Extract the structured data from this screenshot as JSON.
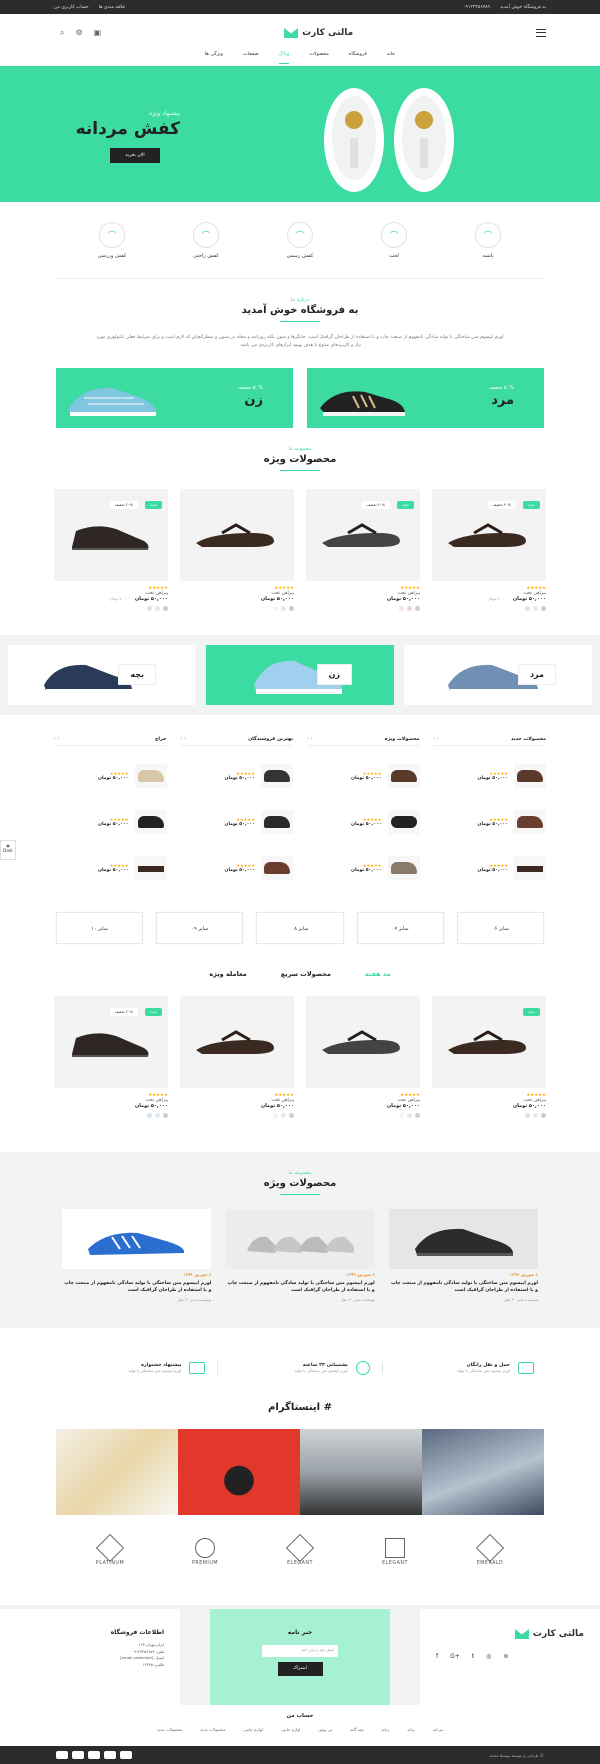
{
  "topbar": {
    "right_text": "به فروشگاه خوش آمدید",
    "phone": "۰۹۱۲۳۴۵۶۷۸۹",
    "wishlist": "علاقه مندی ها",
    "account": "حساب کاربری من"
  },
  "header": {
    "logo": "مالتی کارت"
  },
  "nav": [
    "خانه",
    "فروشگاه",
    "محصولات",
    "وبلاگ",
    "صفحات",
    "ویژگی ها"
  ],
  "hero": {
    "sub": "پیشنهاد ویژه",
    "title": "کفش مردانه",
    "button": "الان بخرید"
  },
  "categories": [
    "پاشنه",
    "لخت",
    "کفش رسمی",
    "کفش راحتی",
    "کفش ورزشی"
  ],
  "welcome": {
    "small": "درباره ما",
    "title": "به فروشگاه خوش آمدید",
    "text": "لورم ایپسوم متن ساختگی با تولید سادگی نامفهوم از صنعت چاپ و با استفاده از طراحان گرافیک است. چاپگرها و متون بلکه روزنامه و مجله در ستون و سطرآنچنان که لازم است و برای شرایط فعلی تکنولوژی مورد نیاز و کاربردهای متنوع با هدف بهبود ابزارهای کاربردی می باشد."
  },
  "banners": [
    {
      "sub": "۵۰% تخفیف",
      "title": "مرد"
    },
    {
      "sub": "۵۰% تخفیف",
      "title": "زن"
    }
  ],
  "featured": {
    "small": "مجموعه ما",
    "title": "محصولات ویژه"
  },
  "product_cards": [
    {
      "badge": "جدید",
      "discount": "۲۰% تخفیف",
      "name": "پیراهن تخت",
      "price": "۵۰,۰۰۰ تومان",
      "old": "۷۰,۰۰۰ تومان"
    },
    {
      "badge": "جدید",
      "discount": "۲۰% تخفیف",
      "name": "پیراهن تخت",
      "price": "۵۰,۰۰۰ تومان",
      "old": ""
    },
    {
      "badge": "",
      "discount": "",
      "name": "پیراهن تخت",
      "price": "۵۰,۰۰۰ تومان",
      "old": ""
    },
    {
      "badge": "جدید",
      "discount": "۲۰% تخفیف",
      "name": "پیراهن تخت",
      "price": "۵۰,۰۰۰ تومان",
      "old": "۷۰,۰۰۰ تومان"
    }
  ],
  "big_cats": [
    "مرد",
    "زن",
    "بچه"
  ],
  "lists": [
    {
      "title": "محصولات جدید",
      "items": [
        {
          "price": "۵۰,۰۰۰ تومان"
        },
        {
          "price": "۵۰,۰۰۰ تومان"
        },
        {
          "price": "۵۰,۰۰۰ تومان"
        }
      ]
    },
    {
      "title": "محصولات ویژه",
      "items": [
        {
          "price": "۵۰,۰۰۰ تومان"
        },
        {
          "price": "۵۰,۰۰۰ تومان"
        },
        {
          "price": "۵۰,۰۰۰ تومان"
        }
      ]
    },
    {
      "title": "بهترین فروشندگان",
      "items": [
        {
          "price": "۵۰,۰۰۰ تومان"
        },
        {
          "price": "۵۰,۰۰۰ تومان"
        },
        {
          "price": "۵۰,۰۰۰ تومان"
        }
      ]
    },
    {
      "title": "حراج",
      "items": [
        {
          "price": "۵۰,۰۰۰ تومان"
        },
        {
          "price": "۵۰,۰۰۰ تومان"
        },
        {
          "price": "۵۰,۰۰۰ تومان"
        }
      ]
    }
  ],
  "sizes": [
    "سایز ۰۶",
    "سایز ۰۷",
    "سایز ۰۸",
    "سایز ۰۹",
    "سایز ۱۰"
  ],
  "tabs": [
    "مد هفته",
    "محصولات سریع",
    "معامله ویژه"
  ],
  "blog": {
    "small": "مجموعه ما",
    "title": "محصولات ویژه",
    "posts": [
      {
        "date": "۸ شهریور ۱۳۹۹",
        "title": "لورم ایپسوم متن ساختگی با تولید سادگی نامفهوم از صنعت چاپ و با استفاده از طراحان گرافیک است",
        "author": "نویسنده مدیر ۳۰ نظر"
      },
      {
        "date": "۸ شهریور ۱۳۹۹",
        "title": "لورم ایپسوم متن ساختگی با تولید سادگی نامفهوم از صنعت چاپ و با استفاده از طراحان گرافیک است",
        "author": "نویسنده مدیر ۳۰ نظر"
      },
      {
        "date": "۸ شهریور ۱۳۹۹",
        "title": "لورم ایپسوم متن ساختگی با تولید سادگی نامفهوم از صنعت چاپ و با استفاده از طراحان گرافیک است",
        "author": "نویسنده مدیر ۳۰ نظر"
      }
    ]
  },
  "features": [
    {
      "title": "حمل و نقل رایگان",
      "desc": "لورم ایپسوم متن ساختگی با تولید"
    },
    {
      "title": "پشتیبانی ۲۴ ساعته",
      "desc": "لورم ایپسوم متن ساختگی با تولید"
    },
    {
      "title": "پیشنهاد جشنواره",
      "desc": "لورم ایپسوم متن ساختگی با تولید"
    }
  ],
  "instagram": {
    "title": "# اینستاگرام"
  },
  "brands": [
    "EMERALD",
    "ELEGANT",
    "ELEGANT",
    "PREMIUM",
    "PLATINUM"
  ],
  "footer": {
    "logo": "مالتی کارت",
    "newsletter_title": "خبر نامه",
    "newsletter_placeholder": "ایمیل خود را وارد کنید",
    "subscribe": "اشتراک",
    "info_title": "اطلاعات فروشگاه",
    "info_lines": [
      "ایران،تهران،۱۲۳",
      "تلفن: ۰۹۱۲۳۴۵۶۷۸۹",
      "ایمیل: [email protected]",
      "فکس: ۱۲۳۴۵"
    ]
  },
  "account": {
    "title": "حساب من",
    "links": [
      "مردانه",
      "زنانه",
      "زنانه",
      "بچه گانه",
      "تی پوش",
      "لوازم جانبی",
      "لوازم جانبی",
      "محصولات جدید",
      "محصولات جدید"
    ]
  },
  "bottom": {
    "copy": "© طراحی و توسعه توسط محمد"
  },
  "dark_toggle": "Dark",
  "colors": {
    "accent": "#3cdba2",
    "dark": "#2c2c2c",
    "star": "#ffae00"
  }
}
